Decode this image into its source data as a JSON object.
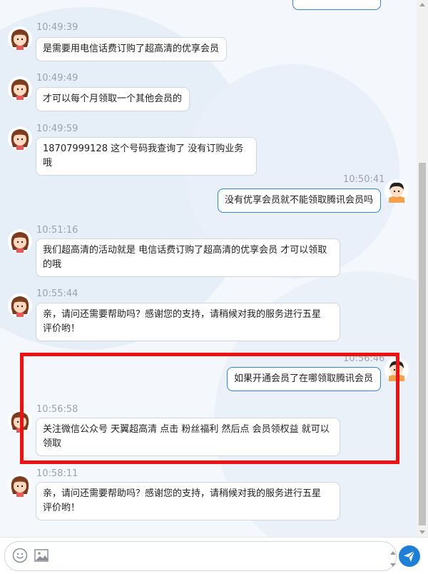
{
  "messages": [
    {
      "time": "10:49:39",
      "lines": [
        "是需要用电信话费订购了超高清的优享会员"
      ]
    },
    {
      "time": "10:49:49",
      "lines": [
        "才可以每个月领取一个其他会员的"
      ]
    },
    {
      "time": "10:49:59",
      "lines": [
        "18707999128 这个号码我查询了 没有订购业务哦"
      ]
    },
    {
      "time": "10:50:41",
      "lines": [
        "没有优享会员就不能领取腾讯会员吗"
      ]
    },
    {
      "time": "10:51:16",
      "lines": [
        "我们超高清的活动就是 电信话费订购了超高清的优享会员 才可以领取",
        "的哦"
      ]
    },
    {
      "time": "10:55:44",
      "lines": [
        "亲，请问还需要帮助吗？感谢您的支持，请稍候对我的服务进行五星",
        "评价哟！"
      ]
    },
    {
      "time": "10:56:46",
      "lines": [
        "如果开通会员了在哪领取腾讯会员"
      ]
    },
    {
      "time": "10:56:58",
      "lines": [
        "关注微信公众号 天翼超高清 点击 粉丝福利 然后点 会员领权益 就可以",
        "领取"
      ]
    },
    {
      "time": "10:58:11",
      "lines": [
        "亲，请问还需要帮助吗？感谢您的支持，请稍候对我的服务进行五星",
        "评价哟！"
      ]
    }
  ],
  "icons": {
    "agent_avatar": "agent-avatar",
    "user_avatar": "user-avatar",
    "emoji": "emoji-icon",
    "image": "image-icon",
    "send": "send-icon"
  },
  "input": {
    "placeholder": ""
  },
  "colors": {
    "accent": "#1f7fd6",
    "highlight": "#ee1111"
  }
}
